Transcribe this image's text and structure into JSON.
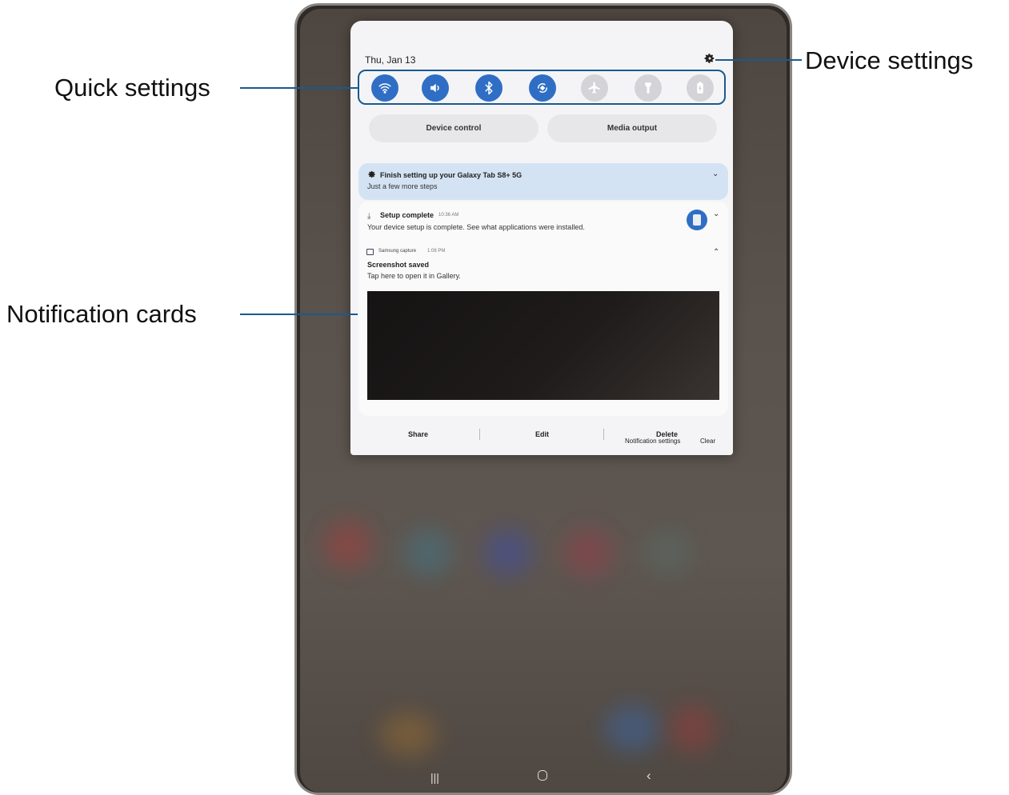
{
  "callouts": {
    "quick_settings": "Quick settings",
    "notification_cards": "Notification cards",
    "device_settings": "Device settings"
  },
  "panel": {
    "date": "Thu, Jan 13",
    "quick_toggles": [
      {
        "name": "wifi-icon",
        "state": "on"
      },
      {
        "name": "sound-icon",
        "state": "on"
      },
      {
        "name": "bluetooth-icon",
        "state": "on"
      },
      {
        "name": "auto-rotate-icon",
        "state": "on"
      },
      {
        "name": "airplane-icon",
        "state": "off"
      },
      {
        "name": "flashlight-icon",
        "state": "off"
      },
      {
        "name": "battery-saver-icon",
        "state": "off"
      }
    ],
    "device_control": "Device control",
    "media_output": "Media output"
  },
  "notifications": {
    "setup_prompt": {
      "title": "Finish setting up your Galaxy Tab S8+ 5G",
      "subtitle": "Just a few more steps"
    },
    "setup_complete": {
      "title": "Setup complete",
      "time": "10:36 AM",
      "body": "Your device setup is complete. See what applications were installed."
    },
    "screenshot": {
      "app": "Samsung capture",
      "time": "1:08 PM",
      "title": "Screenshot saved",
      "body": "Tap here to open it in Gallery.",
      "actions": {
        "share": "Share",
        "edit": "Edit",
        "delete": "Delete"
      }
    },
    "footer": {
      "settings": "Notification settings",
      "clear": "Clear"
    }
  },
  "colors": {
    "accent": "#2f6ec4",
    "callout_line": "#1a5a8e"
  }
}
